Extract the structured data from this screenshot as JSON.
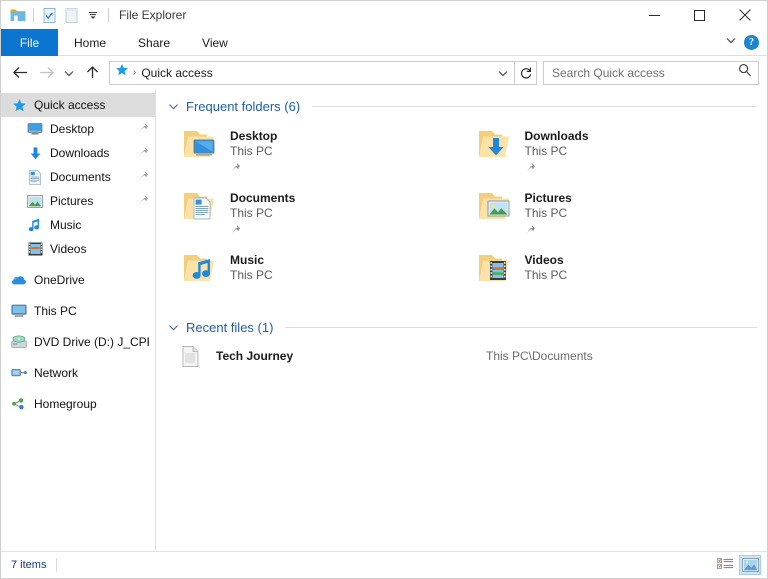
{
  "window": {
    "title": "File Explorer",
    "quick_access_toolbar": [
      {
        "name": "explorer-folder-icon",
        "label": "File Explorer"
      },
      {
        "name": "properties-icon",
        "label": "Properties"
      },
      {
        "name": "new-folder-icon",
        "label": "New folder"
      },
      {
        "name": "customize-qat-chevron-icon",
        "label": "Customize Quick Access Toolbar"
      }
    ],
    "controls": {
      "minimize": "─",
      "maximize": "□",
      "close": "✕"
    }
  },
  "ribbon": {
    "tabs": [
      {
        "label": "File",
        "active": true
      },
      {
        "label": "Home",
        "active": false
      },
      {
        "label": "Share",
        "active": false
      },
      {
        "label": "View",
        "active": false
      }
    ],
    "collapse_label": "⌄",
    "help_label": "?"
  },
  "navbar": {
    "back_label": "Back",
    "forward_label": "Forward",
    "recent_locations_label": "Recent locations",
    "up_label": "Up",
    "address": {
      "icon": "quick-access-star-icon",
      "crumb": "Quick access",
      "separator": "›",
      "dropdown_label": "Previous locations"
    },
    "refresh_label": "Refresh",
    "search": {
      "placeholder": "Search Quick access",
      "icon": "search-icon"
    }
  },
  "sidebar": {
    "items": [
      {
        "label": "Quick access",
        "icon": "star-icon",
        "selected": true,
        "indent": false,
        "pinned": false
      },
      {
        "label": "Desktop",
        "icon": "desktop-icon",
        "selected": false,
        "indent": true,
        "pinned": true
      },
      {
        "label": "Downloads",
        "icon": "download-arrow-icon",
        "selected": false,
        "indent": true,
        "pinned": true
      },
      {
        "label": "Documents",
        "icon": "document-icon",
        "selected": false,
        "indent": true,
        "pinned": true
      },
      {
        "label": "Pictures",
        "icon": "picture-icon",
        "selected": false,
        "indent": true,
        "pinned": true
      },
      {
        "label": "Music",
        "icon": "music-note-icon",
        "selected": false,
        "indent": true,
        "pinned": false
      },
      {
        "label": "Videos",
        "icon": "film-strip-icon",
        "selected": false,
        "indent": true,
        "pinned": false
      },
      {
        "label": "OneDrive",
        "icon": "onedrive-cloud-icon",
        "selected": false,
        "indent": false,
        "pinned": false,
        "spacer_before": true
      },
      {
        "label": "This PC",
        "icon": "this-pc-monitor-icon",
        "selected": false,
        "indent": false,
        "pinned": false,
        "spacer_before": true
      },
      {
        "label": "DVD Drive (D:) J_CPR,",
        "icon": "dvd-drive-icon",
        "selected": false,
        "indent": false,
        "pinned": false,
        "spacer_before": true
      },
      {
        "label": "Network",
        "icon": "network-icon",
        "selected": false,
        "indent": false,
        "pinned": false,
        "spacer_before": true
      },
      {
        "label": "Homegroup",
        "icon": "homegroup-icon",
        "selected": false,
        "indent": false,
        "pinned": false,
        "spacer_before": true
      }
    ]
  },
  "main": {
    "frequent": {
      "title": "Frequent folders (6)",
      "chevron": "⌄",
      "items": [
        {
          "name": "Desktop",
          "subtitle": "This PC",
          "icon": "folder-desktop-icon",
          "pinned": true
        },
        {
          "name": "Downloads",
          "subtitle": "This PC",
          "icon": "folder-downloads-icon",
          "pinned": true
        },
        {
          "name": "Documents",
          "subtitle": "This PC",
          "icon": "folder-documents-icon",
          "pinned": true
        },
        {
          "name": "Pictures",
          "subtitle": "This PC",
          "icon": "folder-pictures-icon",
          "pinned": true
        },
        {
          "name": "Music",
          "subtitle": "This PC",
          "icon": "folder-music-icon",
          "pinned": false
        },
        {
          "name": "Videos",
          "subtitle": "This PC",
          "icon": "folder-videos-icon",
          "pinned": false
        }
      ]
    },
    "recent": {
      "title": "Recent files (1)",
      "chevron": "⌄",
      "items": [
        {
          "name": "Tech Journey",
          "path": "This PC\\Documents",
          "icon": "text-document-icon"
        }
      ]
    }
  },
  "statusbar": {
    "item_count": "7 items",
    "views": [
      {
        "name": "details-view-button",
        "label": "Details view",
        "active": false
      },
      {
        "name": "large-icons-view-button",
        "label": "Large icons view",
        "active": true
      }
    ]
  },
  "colors": {
    "accent": "#0c75d0",
    "section_title": "#1f5fa9",
    "folder": "#f9d67a",
    "selection": "#dcdcdc"
  }
}
